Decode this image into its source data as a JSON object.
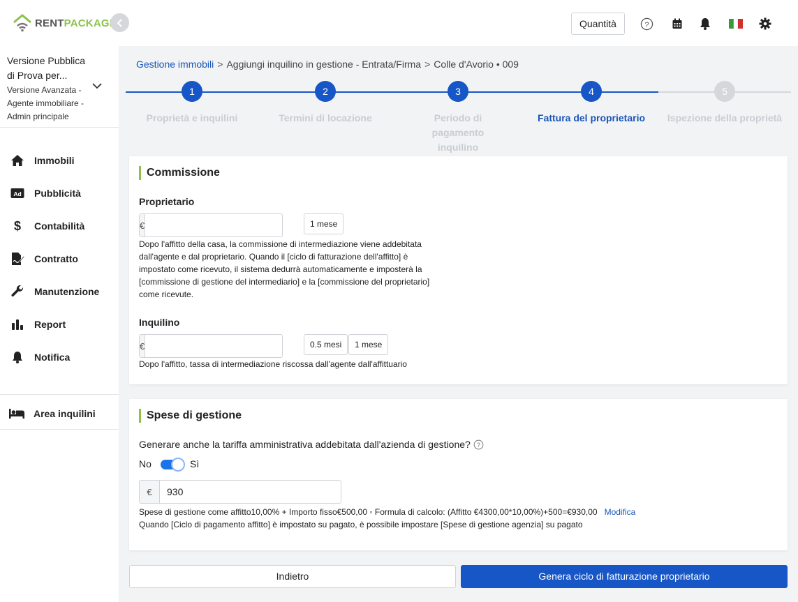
{
  "brand": {
    "rent": "RENT",
    "package": "PACKAGE"
  },
  "header": {
    "quantity_label": "Quantità",
    "icons": [
      "help-icon",
      "calendar-icon",
      "bell-icon",
      "italy-flag-icon",
      "settings-icon"
    ]
  },
  "account": {
    "name": "Versione Pubblica di Prova per...",
    "role": "Versione Avanzata - Agente immobiliare - Admin principale"
  },
  "nav": {
    "items": [
      {
        "label": "Immobili",
        "icon": "home-icon"
      },
      {
        "label": "Pubblicità",
        "icon": "ad-icon"
      },
      {
        "label": "Contabilità",
        "icon": "dollar-icon"
      },
      {
        "label": "Contratto",
        "icon": "contract-icon"
      },
      {
        "label": "Manutenzione",
        "icon": "wrench-icon"
      },
      {
        "label": "Report",
        "icon": "bar-chart-icon"
      },
      {
        "label": "Notifica",
        "icon": "bell-icon"
      }
    ],
    "tenant_area": "Area inquilini"
  },
  "breadcrumb": {
    "link": "Gestione immobili",
    "step2": "Aggiungi inquilino in gestione - Entrata/Firma",
    "step3": "Colle d'Avorio • 009",
    "separator": ">"
  },
  "stepper": {
    "steps": [
      {
        "number": "1",
        "label": "Proprietà e inquilini",
        "state": "done"
      },
      {
        "number": "2",
        "label": "Termini di locazione",
        "state": "done"
      },
      {
        "number": "3",
        "label": "Periodo di pagamento inquilino",
        "state": "done"
      },
      {
        "number": "4",
        "label": "Fattura del proprietario",
        "state": "active"
      },
      {
        "number": "5",
        "label": "Ispezione della proprietà",
        "state": "pending"
      }
    ]
  },
  "commission": {
    "title": "Commissione",
    "owner": {
      "label": "Proprietario",
      "currency": "€",
      "value": "",
      "chips": [
        "1 mese"
      ],
      "help": "Dopo l'affitto della casa, la commissione di intermediazione viene addebitata dall'agente e dal proprietario. Quando il [ciclo di fatturazione dell'affitto] è impostato come ricevuto, il sistema dedurrà automaticamente e imposterà la [commissione di gestione del intermediario] e la [commissione del proprietario] come ricevute."
    },
    "tenant": {
      "label": "Inquilino",
      "currency": "€",
      "value": "",
      "chips": [
        "0.5 mesi",
        "1 mese"
      ],
      "help": "Dopo l'affitto, tassa di intermediazione riscossa dall'agente dall'affittuario"
    }
  },
  "management": {
    "title": "Spese di gestione",
    "question": "Generare anche la tariffa amministrativa addebitata dall'azienda di gestione?",
    "toggle_off": "No",
    "toggle_on": "Sì",
    "toggle_state": true,
    "currency": "€",
    "value": "930",
    "formula": "Spese di gestione come affitto10,00% + Importo fisso€500,00 ◦ Formula di calcolo: (Affitto €4300,00*10,00%)+500=€930,00",
    "edit_link": "Modifica",
    "note": "Quando [Ciclo di pagamento affitto] è impostato su pagato, è possibile impostare [Spese di gestione agenzia] su pagato"
  },
  "actions": {
    "back": "Indietro",
    "generate": "Genera ciclo di fatturazione proprietario"
  },
  "colors": {
    "accent": "#1756c6",
    "brand_green": "#8bc34a",
    "step_pending": "#d5d7da"
  }
}
